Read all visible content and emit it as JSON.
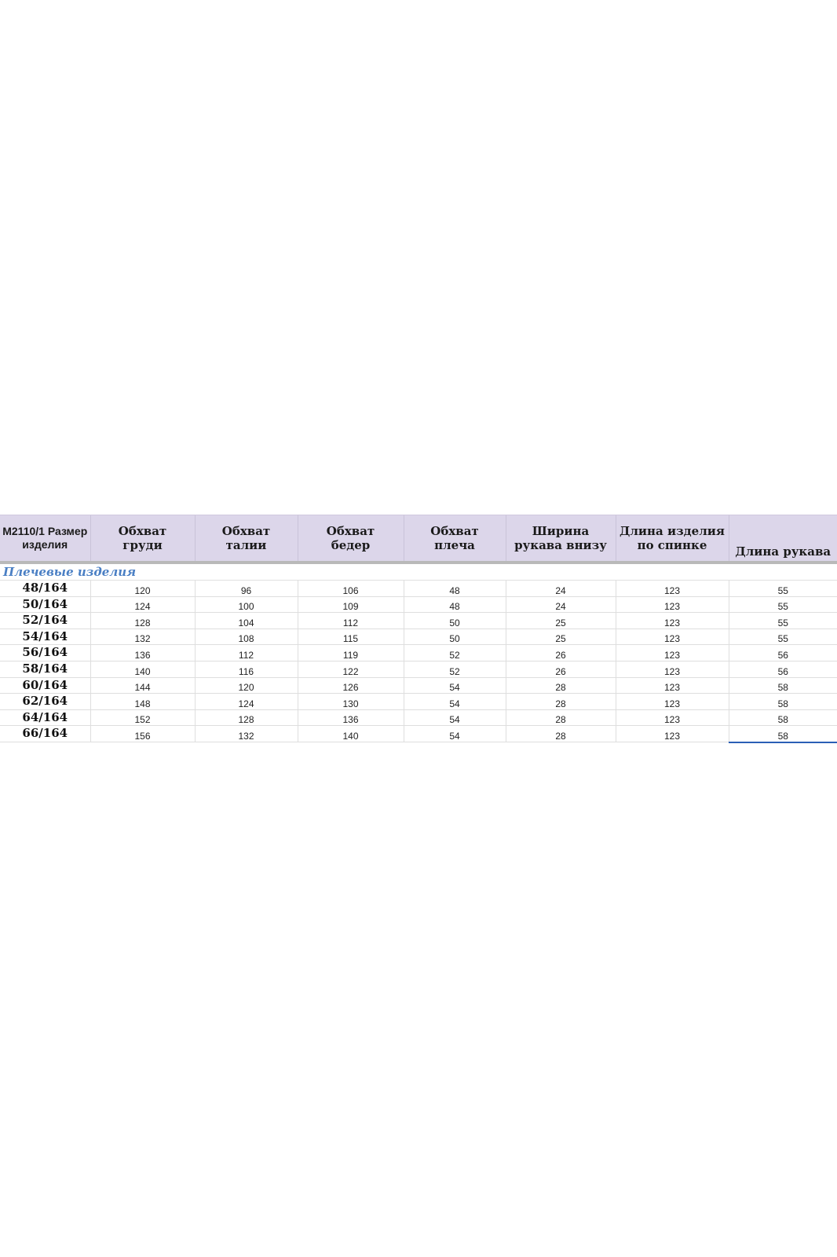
{
  "table": {
    "headers": [
      "M2110/1 Размер\nизделия",
      "Обхват\nгруди",
      "Обхват\nталии",
      "Обхват\nбедер",
      "Обхват\nплеча",
      "Ширина\nрукава внизу",
      "Длина изделия\nпо спинке",
      "Длина рукава"
    ],
    "section_label": "Плечевые изделия",
    "rows": [
      [
        "48/164",
        "120",
        "96",
        "106",
        "48",
        "24",
        "123",
        "55"
      ],
      [
        "50/164",
        "124",
        "100",
        "109",
        "48",
        "24",
        "123",
        "55"
      ],
      [
        "52/164",
        "128",
        "104",
        "112",
        "50",
        "25",
        "123",
        "55"
      ],
      [
        "54/164",
        "132",
        "108",
        "115",
        "50",
        "25",
        "123",
        "55"
      ],
      [
        "56/164",
        "136",
        "112",
        "119",
        "52",
        "26",
        "123",
        "56"
      ],
      [
        "58/164",
        "140",
        "116",
        "122",
        "52",
        "26",
        "123",
        "56"
      ],
      [
        "60/164",
        "144",
        "120",
        "126",
        "54",
        "28",
        "123",
        "58"
      ],
      [
        "62/164",
        "148",
        "124",
        "130",
        "54",
        "28",
        "123",
        "58"
      ],
      [
        "64/164",
        "152",
        "128",
        "136",
        "54",
        "28",
        "123",
        "58"
      ],
      [
        "66/164",
        "156",
        "132",
        "140",
        "54",
        "28",
        "123",
        "58"
      ]
    ]
  },
  "colors": {
    "header_bg": "#dcd6ea",
    "section_text": "#4a7fc4",
    "selection": "#2a5fb6"
  }
}
